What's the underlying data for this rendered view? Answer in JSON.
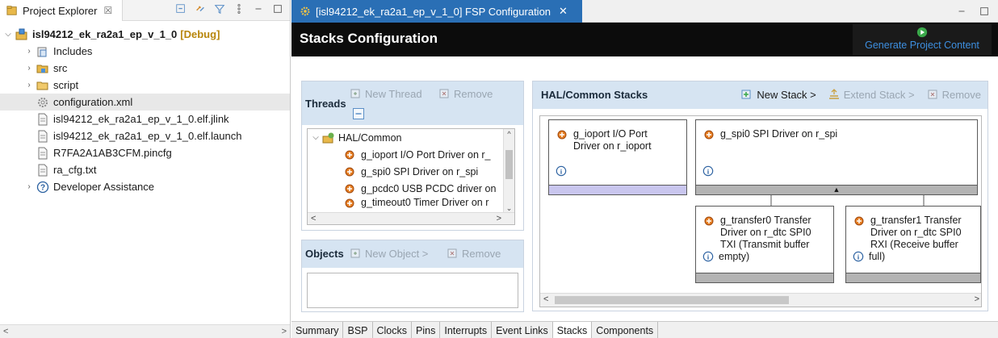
{
  "project_explorer": {
    "tab_label": "Project Explorer",
    "tab_close": "☒",
    "project": {
      "name": "isl94212_ek_ra2a1_ep_v_1_0",
      "config": "[Debug]"
    },
    "items": [
      {
        "label": "Includes",
        "icon": "includes-icon",
        "expandable": true
      },
      {
        "label": "src",
        "icon": "source-folder-icon",
        "expandable": true
      },
      {
        "label": "script",
        "icon": "folder-icon",
        "expandable": true
      },
      {
        "label": "configuration.xml",
        "icon": "config-gear-icon",
        "expandable": false,
        "selected": true
      },
      {
        "label": "isl94212_ek_ra2a1_ep_v_1_0.elf.jlink",
        "icon": "file-icon",
        "expandable": false
      },
      {
        "label": "isl94212_ek_ra2a1_ep_v_1_0.elf.launch",
        "icon": "file-icon",
        "expandable": false
      },
      {
        "label": "R7FA2A1AB3CFM.pincfg",
        "icon": "file-icon",
        "expandable": false
      },
      {
        "label": "ra_cfg.txt",
        "icon": "file-icon",
        "expandable": false
      },
      {
        "label": "Developer Assistance",
        "icon": "help-circle-icon",
        "expandable": true
      }
    ]
  },
  "editor": {
    "tab_label": "[isl94212_ek_ra2a1_ep_v_1_0] FSP Configuration",
    "tab_close": "✕",
    "header_title": "Stacks Configuration",
    "generate_label": "Generate Project Content",
    "threads": {
      "title": "Threads",
      "new_thread": "New Thread",
      "remove": "Remove",
      "group": "HAL/Common",
      "items": [
        "g_ioport I/O Port Driver on r_",
        "g_spi0 SPI Driver on r_spi",
        "g_pcdc0 USB PCDC driver on",
        "g_timeout0 Timer Driver on r"
      ]
    },
    "objects": {
      "title": "Objects",
      "new_object": "New Object >",
      "remove": "Remove"
    },
    "hal": {
      "title": "HAL/Common Stacks",
      "new_stack": "New Stack >",
      "extend_stack": "Extend Stack >",
      "remove": "Remove",
      "modules": [
        {
          "line1": "g_ioport I/O Port",
          "line2": "Driver on r_ioport",
          "line3": "",
          "line4": ""
        },
        {
          "line1": "g_spi0 SPI Driver on r_spi",
          "line2": "",
          "line3": "",
          "line4": ""
        },
        {
          "line1": "g_transfer0 Transfer",
          "line2": "Driver on r_dtc SPI0",
          "line3": "TXI (Transmit buffer",
          "line4": "empty)"
        },
        {
          "line1": "g_transfer1 Transfer",
          "line2": "Driver on r_dtc SPI0",
          "line3": "RXI (Receive buffer",
          "line4": "full)"
        }
      ]
    },
    "bottom_tabs": [
      "Summary",
      "BSP",
      "Clocks",
      "Pins",
      "Interrupts",
      "Event Links",
      "Stacks",
      "Components"
    ],
    "active_tab": "Stacks"
  },
  "colors": {
    "editor_tab": "#2a6fb5",
    "header_bg": "#0c0c0c",
    "panel_head": "#d6e4f2",
    "module_bar_selected": "#c9c6ee",
    "module_bar": "#b3b3b3",
    "generate_text": "#3d8fe0"
  }
}
